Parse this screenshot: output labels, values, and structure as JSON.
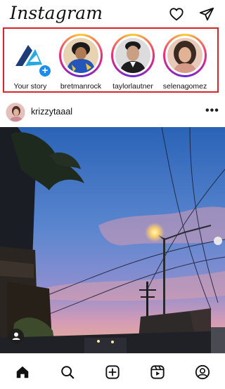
{
  "header": {
    "logo": "Instagram",
    "icons": [
      "heart-icon",
      "send-icon"
    ]
  },
  "stories": [
    {
      "name": "Your story",
      "own": true
    },
    {
      "name": "bretmanrock",
      "own": false
    },
    {
      "name": "taylorlautner",
      "own": false
    },
    {
      "name": "selenagomez",
      "own": false
    }
  ],
  "post": {
    "username": "krizzytaaal",
    "more_label": "•••"
  },
  "tabbar": {
    "tabs": [
      "home-icon",
      "search-icon",
      "create-icon",
      "reels-icon",
      "profile-icon"
    ]
  },
  "colors": {
    "highlight_border": "#d9252a",
    "add_story_blue": "#1b8cf0",
    "story_ring_start": "#f9ce34",
    "story_ring_mid": "#ee2a7b",
    "story_ring_end": "#6228d7"
  }
}
